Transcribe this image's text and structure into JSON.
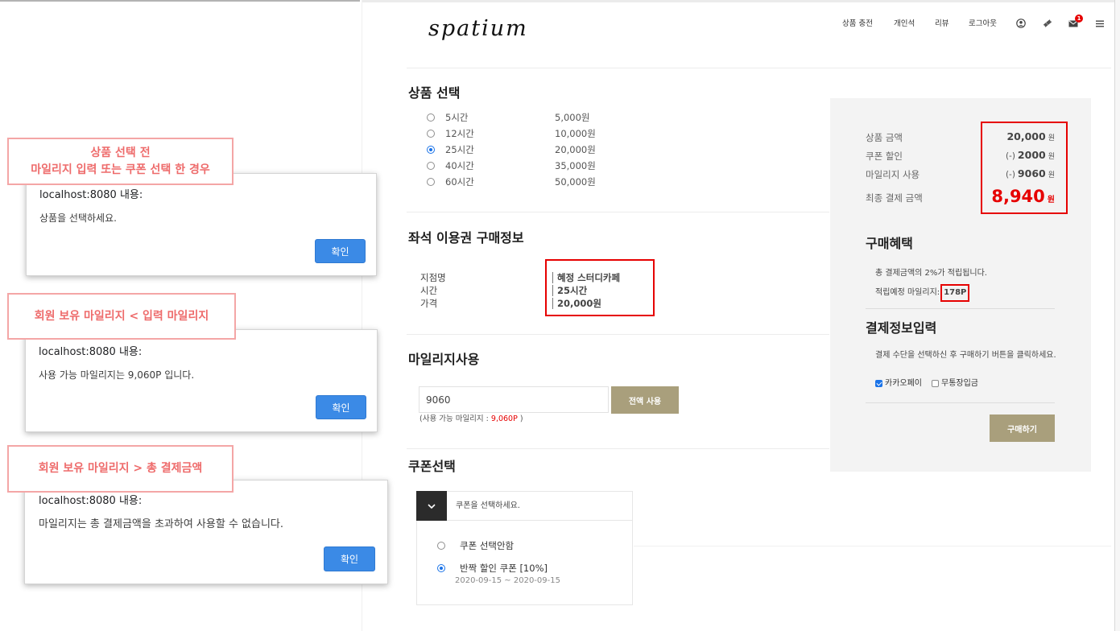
{
  "annotations": [
    {
      "lines": [
        "상품 선택 전",
        "마일리지 입력 또는 쿠폰 선택 한 경우"
      ]
    },
    {
      "lines": [
        "회원 보유 마일리지 < 입력 마일리지"
      ]
    },
    {
      "lines": [
        "회원 보유 마일리지 > 총 결제금액"
      ]
    }
  ],
  "dialogs": [
    {
      "title": "localhost:8080 내용:",
      "message": "상품을 선택하세요.",
      "button": "확인"
    },
    {
      "title": "localhost:8080 내용:",
      "message": "사용 가능 마일리지는 9,060P 입니다.",
      "button": "확인"
    },
    {
      "title": "localhost:8080 내용:",
      "message": "마일리지는 총 결제금액을 초과하여 사용할 수 없습니다.",
      "button": "확인"
    }
  ],
  "header": {
    "logo": "spatium",
    "nav": [
      {
        "label": "상품 충전"
      },
      {
        "label": "개인석"
      },
      {
        "label": "리뷰"
      },
      {
        "label": "로그아웃"
      }
    ],
    "icons": [
      "user-icon",
      "ticket-icon",
      "mail-icon",
      "menu-icon"
    ],
    "mail_badge": "1"
  },
  "product": {
    "title": "상품 선택",
    "options": [
      {
        "label": "5시간",
        "price": "5,000원",
        "selected": false
      },
      {
        "label": "12시간",
        "price": "10,000원",
        "selected": false
      },
      {
        "label": "25시간",
        "price": "20,000원",
        "selected": true
      },
      {
        "label": "40시간",
        "price": "35,000원",
        "selected": false
      },
      {
        "label": "60시간",
        "price": "50,000원",
        "selected": false
      }
    ]
  },
  "purchase_info": {
    "title": "좌석 이용권 구매정보",
    "rows": [
      {
        "label": "지점명",
        "value": "혜정 스터디카페"
      },
      {
        "label": "시간",
        "value": "25시간"
      },
      {
        "label": "가격",
        "value": "20,000원"
      }
    ]
  },
  "mileage": {
    "title": "마일리지사용",
    "input_value": "9060",
    "use_all_label": "전액 사용",
    "hint_prefix": "(사용 가능 마일리지 : ",
    "hint_value": "9,060P",
    "hint_suffix": " )"
  },
  "coupon": {
    "title": "쿠폰선택",
    "placeholder": "쿠폰을 선택하세요.",
    "options": [
      {
        "label": "쿠폰 선택안함",
        "selected": false
      },
      {
        "label": "반짝 할인 쿠폰 [10%]",
        "selected": true,
        "period": "2020-09-15 ~ 2020-09-15"
      }
    ]
  },
  "summary": {
    "rows": [
      {
        "label": "상품 금액",
        "value": "20,000",
        "unit": "원"
      },
      {
        "label": "쿠폰 할인",
        "prefix": "(-)",
        "value": "2000",
        "unit": "원"
      },
      {
        "label": "마일리지 사용",
        "prefix": "(-)",
        "value": "9060",
        "unit": "원"
      }
    ],
    "total": {
      "label": "최종 결제 금액",
      "value": "8,940",
      "unit": "원"
    }
  },
  "benefit": {
    "title": "구매혜택",
    "text": "총 결제금액의 2%가 적립됩니다.",
    "mileage_label": "적립예정 마일리지:",
    "mileage_value": "178P"
  },
  "payment": {
    "title": "결제정보입력",
    "desc": "결제 수단을 선택하신 후 구매하기 버튼을 클릭하세요.",
    "methods": [
      {
        "label": "카카오페이",
        "checked": true
      },
      {
        "label": "무통장입금",
        "checked": false
      }
    ],
    "submit_label": "구매하기"
  },
  "colors": {
    "accent": "#a99f7c",
    "highlight_red": "#e60000",
    "annotation": "#ee6b6b",
    "dialog_button": "#3b8ae6"
  }
}
